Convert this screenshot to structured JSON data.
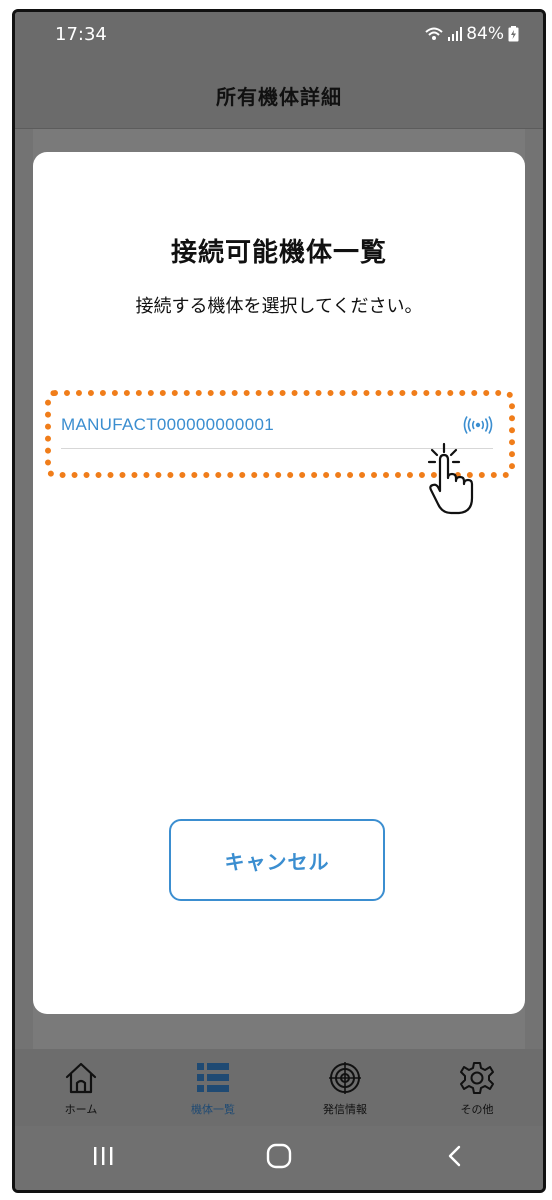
{
  "status_bar": {
    "time": "17:34",
    "battery": "84%"
  },
  "header": {
    "title": "所有機体詳細"
  },
  "dialog": {
    "title": "接続可能機体一覧",
    "subtitle": "接続する機体を選択してください。",
    "devices": [
      {
        "name": "MANUFACT000000000001",
        "icon": "signal-broadcast-icon"
      }
    ],
    "cancel_label": "キャンセル"
  },
  "bottom_nav": {
    "items": [
      {
        "label": "ホーム",
        "icon": "home-icon",
        "active": false
      },
      {
        "label": "機体一覧",
        "icon": "list-icon",
        "active": true
      },
      {
        "label": "発信情報",
        "icon": "target-icon",
        "active": false
      },
      {
        "label": "その他",
        "icon": "gear-icon",
        "active": false
      }
    ]
  },
  "colors": {
    "accent": "#3b8ed0",
    "highlight": "#f07d1a",
    "nav_active": "#1f4a73"
  }
}
